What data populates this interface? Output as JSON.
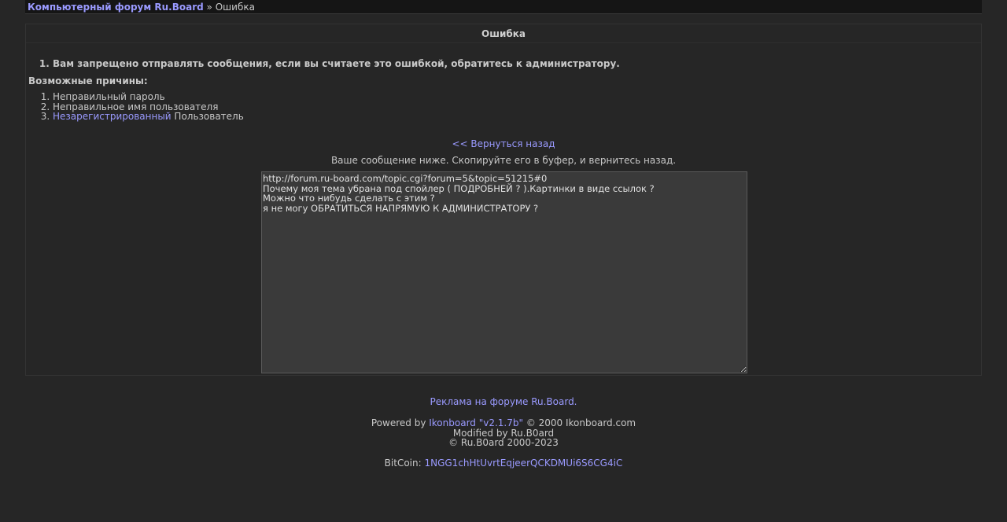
{
  "nav": {
    "forum_link": "Компьютерный форум Ru.Board",
    "separator": "»",
    "current": "Ошибка"
  },
  "panel": {
    "title": "Ошибка",
    "error_message": "Вам запрещено отправлять сообщения, если вы считаете это ошибкой, обратитесь к администратору.",
    "reasons_title": "Возможные причины:",
    "reason_1": "Неправильный пароль",
    "reason_2": "Неправильное имя пользователя",
    "reason_3_link": "Незарегистрированный",
    "reason_3_text": " Пользователь",
    "back_link": "<< Вернуться назад",
    "copy_note": "Ваше сообщение ниже. Скопируйте его в буфер, и вернитесь назад.",
    "message_text": "http://forum.ru-board.com/topic.cgi?forum=5&topic=51215#0\nПочему моя тема убрана под спойлер ( ПОДРОБНЕЙ ? ).Картинки в виде ссылок ?\nМожно что нибудь сделать с этим ?\nя не могу ОБРАТИТЬСЯ НАПРЯМУЮ К АДМИНИСТРАТОРУ ?"
  },
  "footer": {
    "ad_link": "Реклама на форуме Ru.Board.",
    "powered_prefix": "Powered by ",
    "powered_link": "Ikonboard \"v2.1.7b\"",
    "powered_suffix": " © 2000 Ikonboard.com",
    "modified": "Modified by Ru.B0ard",
    "copyright": "© Ru.B0ard 2000-2023",
    "bitcoin_label": "BitCoin: ",
    "bitcoin_address": "1NGG1chHtUvrtEqjeerQCKDMUi6S6CG4iC"
  }
}
